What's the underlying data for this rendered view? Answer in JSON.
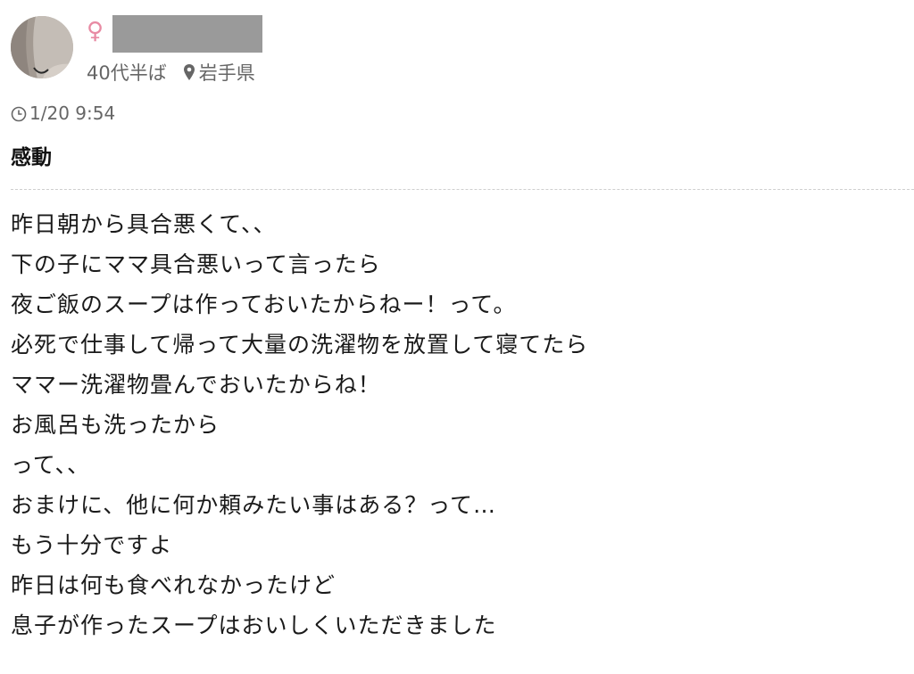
{
  "author": {
    "gender_symbol": "♀",
    "age": "40代半ば",
    "location": "岩手県"
  },
  "post": {
    "timestamp": "1/20 9:54",
    "title": "感動",
    "body_lines": [
      "昨日朝から具合悪くて、、",
      "下の子にママ具合悪いって言ったら",
      "夜ご飯のスープは作っておいたからねー！って。",
      "必死で仕事して帰って大量の洗濯物を放置して寝てたら",
      "ママー洗濯物畳んでおいたからね！",
      "お風呂も洗ったから",
      "って、、",
      "おまけに、他に何か頼みたい事はある？って…",
      "もう十分ですよ",
      "昨日は何も食べれなかったけど",
      "息子が作ったスープはおいしくいただきました"
    ]
  },
  "colors": {
    "gender_female": "#e88aa3",
    "meta_text": "#666666",
    "body_text": "#1a1a1a",
    "divider": "#cfcfcf",
    "redaction": "#9a9a9a"
  },
  "icons": {
    "location": "location-pin-icon",
    "time": "clock-icon"
  }
}
